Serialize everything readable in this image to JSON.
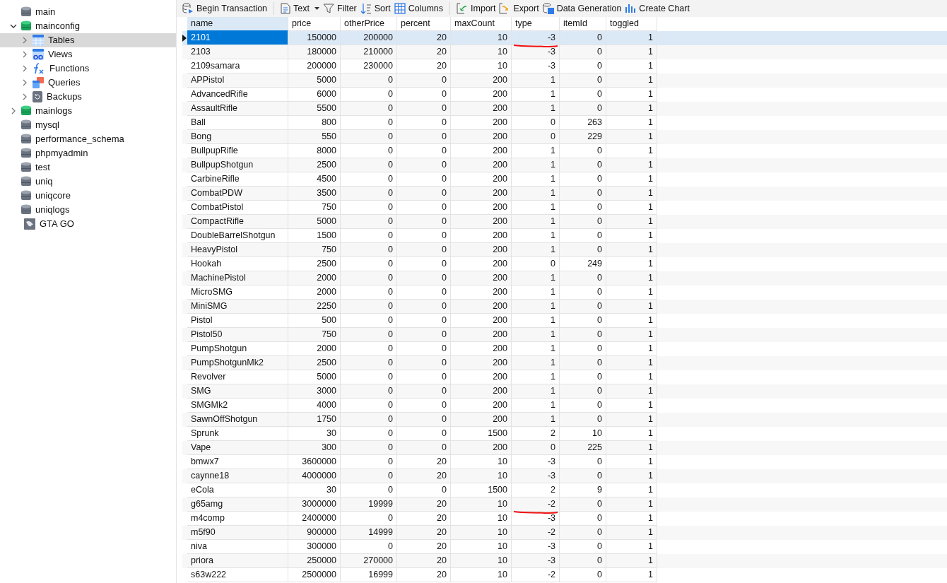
{
  "sidebar": {
    "items": [
      {
        "label": "main",
        "kind": "db-gray",
        "selected": false
      },
      {
        "label": "mainconfig",
        "kind": "db-green",
        "expanded": true,
        "selected": false,
        "children": [
          {
            "label": "Tables",
            "kind": "tables",
            "expanded": false,
            "selected": true
          },
          {
            "label": "Views",
            "kind": "views",
            "expanded": false,
            "selected": false
          },
          {
            "label": "Functions",
            "kind": "functions",
            "expanded": false,
            "selected": false
          },
          {
            "label": "Queries",
            "kind": "queries",
            "expanded": false,
            "selected": false
          },
          {
            "label": "Backups",
            "kind": "backups",
            "expanded": false,
            "selected": false
          }
        ]
      },
      {
        "label": "mainlogs",
        "kind": "db-green",
        "expanded": false,
        "selected": false
      },
      {
        "label": "mysql",
        "kind": "db-gray",
        "selected": false
      },
      {
        "label": "performance_schema",
        "kind": "db-gray",
        "selected": false
      },
      {
        "label": "phpmyadmin",
        "kind": "db-gray",
        "selected": false
      },
      {
        "label": "test",
        "kind": "db-gray",
        "selected": false
      },
      {
        "label": "uniq",
        "kind": "db-gray",
        "selected": false
      },
      {
        "label": "uniqcore",
        "kind": "db-gray",
        "selected": false
      },
      {
        "label": "uniqlogs",
        "kind": "db-gray",
        "selected": false
      },
      {
        "label": "GTA GO",
        "kind": "connection",
        "selected": false
      }
    ]
  },
  "toolbar": [
    {
      "label": "Begin Transaction",
      "kind": "transaction"
    },
    {
      "label": "Text",
      "kind": "text"
    },
    {
      "label": "Filter",
      "kind": "filter"
    },
    {
      "label": "Sort",
      "kind": "sort"
    },
    {
      "label": "Columns",
      "kind": "columns"
    },
    {
      "label": "Import",
      "kind": "import"
    },
    {
      "label": "Export",
      "kind": "export"
    },
    {
      "label": "Data Generation",
      "kind": "generation"
    },
    {
      "label": "Create Chart",
      "kind": "chart"
    }
  ],
  "table": {
    "columns": [
      {
        "label": "name",
        "selected": true
      },
      {
        "label": "price",
        "selected": false
      },
      {
        "label": "otherPrice",
        "selected": false
      },
      {
        "label": "percent",
        "selected": false
      },
      {
        "label": "maxCount",
        "selected": false
      },
      {
        "label": "type",
        "selected": false
      },
      {
        "label": "itemId",
        "selected": false
      },
      {
        "label": "toggled",
        "selected": false
      }
    ],
    "rows": [
      {
        "cells": [
          "2101",
          "150000",
          "200000",
          "20",
          "10",
          "-3",
          "0",
          "1"
        ],
        "selected": true,
        "type_underlined": true
      },
      {
        "cells": [
          "2103",
          "180000",
          "210000",
          "20",
          "10",
          "-3",
          "0",
          "1"
        ],
        "selected": false,
        "type_underlined": false
      },
      {
        "cells": [
          "2109samara",
          "200000",
          "230000",
          "20",
          "10",
          "-3",
          "0",
          "1"
        ],
        "selected": false,
        "type_underlined": false
      },
      {
        "cells": [
          "APPistol",
          "5000",
          "0",
          "0",
          "200",
          "1",
          "0",
          "1"
        ],
        "selected": false,
        "type_underlined": false
      },
      {
        "cells": [
          "AdvancedRifle",
          "6000",
          "0",
          "0",
          "200",
          "1",
          "0",
          "1"
        ],
        "selected": false,
        "type_underlined": false
      },
      {
        "cells": [
          "AssaultRifle",
          "5500",
          "0",
          "0",
          "200",
          "1",
          "0",
          "1"
        ],
        "selected": false,
        "type_underlined": false
      },
      {
        "cells": [
          "Ball",
          "800",
          "0",
          "0",
          "200",
          "0",
          "263",
          "1"
        ],
        "selected": false,
        "type_underlined": false
      },
      {
        "cells": [
          "Bong",
          "550",
          "0",
          "0",
          "200",
          "0",
          "229",
          "1"
        ],
        "selected": false,
        "type_underlined": false
      },
      {
        "cells": [
          "BullpupRifle",
          "8000",
          "0",
          "0",
          "200",
          "1",
          "0",
          "1"
        ],
        "selected": false,
        "type_underlined": false
      },
      {
        "cells": [
          "BullpupShotgun",
          "2500",
          "0",
          "0",
          "200",
          "1",
          "0",
          "1"
        ],
        "selected": false,
        "type_underlined": false
      },
      {
        "cells": [
          "CarbineRifle",
          "4500",
          "0",
          "0",
          "200",
          "1",
          "0",
          "1"
        ],
        "selected": false,
        "type_underlined": false
      },
      {
        "cells": [
          "CombatPDW",
          "3500",
          "0",
          "0",
          "200",
          "1",
          "0",
          "1"
        ],
        "selected": false,
        "type_underlined": false
      },
      {
        "cells": [
          "CombatPistol",
          "750",
          "0",
          "0",
          "200",
          "1",
          "0",
          "1"
        ],
        "selected": false,
        "type_underlined": false
      },
      {
        "cells": [
          "CompactRifle",
          "5000",
          "0",
          "0",
          "200",
          "1",
          "0",
          "1"
        ],
        "selected": false,
        "type_underlined": false
      },
      {
        "cells": [
          "DoubleBarrelShotgun",
          "1500",
          "0",
          "0",
          "200",
          "1",
          "0",
          "1"
        ],
        "selected": false,
        "type_underlined": false
      },
      {
        "cells": [
          "HeavyPistol",
          "750",
          "0",
          "0",
          "200",
          "1",
          "0",
          "1"
        ],
        "selected": false,
        "type_underlined": false
      },
      {
        "cells": [
          "Hookah",
          "2500",
          "0",
          "0",
          "200",
          "0",
          "249",
          "1"
        ],
        "selected": false,
        "type_underlined": false
      },
      {
        "cells": [
          "MachinePistol",
          "2000",
          "0",
          "0",
          "200",
          "1",
          "0",
          "1"
        ],
        "selected": false,
        "type_underlined": false
      },
      {
        "cells": [
          "MicroSMG",
          "2000",
          "0",
          "0",
          "200",
          "1",
          "0",
          "1"
        ],
        "selected": false,
        "type_underlined": false
      },
      {
        "cells": [
          "MiniSMG",
          "2250",
          "0",
          "0",
          "200",
          "1",
          "0",
          "1"
        ],
        "selected": false,
        "type_underlined": false
      },
      {
        "cells": [
          "Pistol",
          "500",
          "0",
          "0",
          "200",
          "1",
          "0",
          "1"
        ],
        "selected": false,
        "type_underlined": false
      },
      {
        "cells": [
          "Pistol50",
          "750",
          "0",
          "0",
          "200",
          "1",
          "0",
          "1"
        ],
        "selected": false,
        "type_underlined": false
      },
      {
        "cells": [
          "PumpShotgun",
          "2000",
          "0",
          "0",
          "200",
          "1",
          "0",
          "1"
        ],
        "selected": false,
        "type_underlined": false
      },
      {
        "cells": [
          "PumpShotgunMk2",
          "2500",
          "0",
          "0",
          "200",
          "1",
          "0",
          "1"
        ],
        "selected": false,
        "type_underlined": false
      },
      {
        "cells": [
          "Revolver",
          "5000",
          "0",
          "0",
          "200",
          "1",
          "0",
          "1"
        ],
        "selected": false,
        "type_underlined": false
      },
      {
        "cells": [
          "SMG",
          "3000",
          "0",
          "0",
          "200",
          "1",
          "0",
          "1"
        ],
        "selected": false,
        "type_underlined": false
      },
      {
        "cells": [
          "SMGMk2",
          "4000",
          "0",
          "0",
          "200",
          "1",
          "0",
          "1"
        ],
        "selected": false,
        "type_underlined": false
      },
      {
        "cells": [
          "SawnOffShotgun",
          "1750",
          "0",
          "0",
          "200",
          "1",
          "0",
          "1"
        ],
        "selected": false,
        "type_underlined": false
      },
      {
        "cells": [
          "Sprunk",
          "30",
          "0",
          "0",
          "1500",
          "2",
          "10",
          "1"
        ],
        "selected": false,
        "type_underlined": false
      },
      {
        "cells": [
          "Vape",
          "300",
          "0",
          "0",
          "200",
          "0",
          "225",
          "1"
        ],
        "selected": false,
        "type_underlined": false
      },
      {
        "cells": [
          "bmwx7",
          "3600000",
          "0",
          "20",
          "10",
          "-3",
          "0",
          "1"
        ],
        "selected": false,
        "type_underlined": false
      },
      {
        "cells": [
          "caynne18",
          "4000000",
          "0",
          "20",
          "10",
          "-3",
          "0",
          "1"
        ],
        "selected": false,
        "type_underlined": false
      },
      {
        "cells": [
          "eCola",
          "30",
          "0",
          "0",
          "1500",
          "2",
          "9",
          "1"
        ],
        "selected": false,
        "type_underlined": false
      },
      {
        "cells": [
          "g65amg",
          "3000000",
          "19999",
          "20",
          "10",
          "-2",
          "0",
          "1"
        ],
        "selected": false,
        "type_underlined": true
      },
      {
        "cells": [
          "m4comp",
          "2400000",
          "0",
          "20",
          "10",
          "-3",
          "0",
          "1"
        ],
        "selected": false,
        "type_underlined": false
      },
      {
        "cells": [
          "m5f90",
          "900000",
          "14999",
          "20",
          "10",
          "-2",
          "0",
          "1"
        ],
        "selected": false,
        "type_underlined": false
      },
      {
        "cells": [
          "niva",
          "300000",
          "0",
          "20",
          "10",
          "-3",
          "0",
          "1"
        ],
        "selected": false,
        "type_underlined": false
      },
      {
        "cells": [
          "priora",
          "250000",
          "270000",
          "20",
          "10",
          "-3",
          "0",
          "1"
        ],
        "selected": false,
        "type_underlined": false
      },
      {
        "cells": [
          "s63w222",
          "2500000",
          "16999",
          "20",
          "10",
          "-2",
          "0",
          "1"
        ],
        "selected": false,
        "type_underlined": false
      }
    ]
  }
}
